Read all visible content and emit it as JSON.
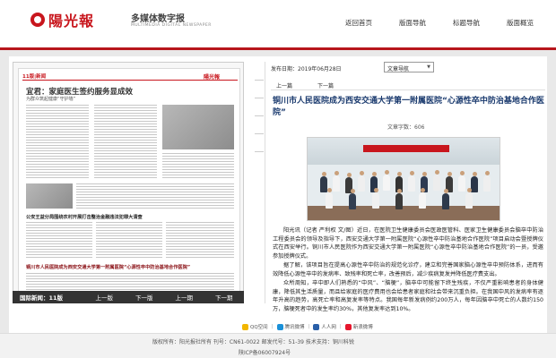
{
  "header": {
    "logo_text": "陽光報",
    "platform_title": "多媒体数字报",
    "platform_sub": "MULTIMEDIA DIGITAL NEWSPAPER"
  },
  "nav": [
    {
      "label": "返回首页"
    },
    {
      "label": "版面导航"
    },
    {
      "label": "标题导航"
    },
    {
      "label": "版面概览"
    }
  ],
  "newspaper": {
    "page_tag": "11版|新闻",
    "logo": "陽光報",
    "lead_title": "宜君：家庭医生签约服务显成效",
    "lead_sub": "为群众筑起健康“守护墙”",
    "headline_2": "公安王益分局围绕农村开展打击整治金融违法犯罪大清查",
    "headline_3": "铜川市人民医院成为西安交通大学第一附属医院“心源性卒中防治基地合作医院”"
  },
  "pagebar": {
    "edition": "国际新闻：11版",
    "buttons": [
      "上一版",
      "下一版",
      "上一期",
      "下一期"
    ]
  },
  "article": {
    "date_label": "发布日期：",
    "date_value": "2019年06月28日",
    "select_label": "文章导航",
    "prev_label": "上一篇",
    "next_label": "下一篇",
    "title": "铜川市人民医院成为西安交通大学第一附属医院“心源性卒中防治基地合作医院”",
    "meta": "文章字数：606",
    "paragraphs": [
      "阳光讯（记者 严利权 文/图）近日，在医院卫生健康委员会医政医管科、医家卫生健康委员会脑卒中防治工程委员会的领导及指导下，西安交通大学第一附属医院“心源性卒中防治基地合作医院”项目启动会暨授牌仪式在西安举行。铜川市人民医院作为西安交通大学第一附属医院“心源性卒中防治基地合作医院”的一员，受邀参加授牌仪式。",
      "据了解，该项目旨在提高心源性卒中防治的规范化诊疗，建立和完善国家脑心源性卒中预防体系，进而有效降低心源性卒中的发病率、致残率和死亡率，改善预后，减少疾病复发并降低医疗费支出。",
      "众所周知，卒中即人们熟悉的“中风”、“脑梗”，脑卒中可能留下终生残疾，不仅严重影响患者的身体健康，降低其生活质量，而且给家庭的医疗费用也会给患者家庭和社会带来沉重负担。在我国中风的发病率有逐年升高的趋势，高死亡率和高复发率等特点。我国每年新发病例约200万人，每年因脑卒中死亡的人数约150万，脑梗死者中的发生率约30%，其他复发率达到10%。"
    ]
  },
  "share": [
    {
      "label": "QQ空间",
      "color": "#f2b600"
    },
    {
      "label": "腾讯微博",
      "color": "#1a90d8"
    },
    {
      "label": "人人网",
      "color": "#2a5fa8"
    },
    {
      "label": "新浪微博",
      "color": "#e6162d"
    }
  ],
  "footer": {
    "line": "版权所有：阳光报社所有 刊号：CN61-0022 邮发代号：51-39 技术支持：铜川科锐",
    "icp": "陕ICP备06007924号"
  }
}
